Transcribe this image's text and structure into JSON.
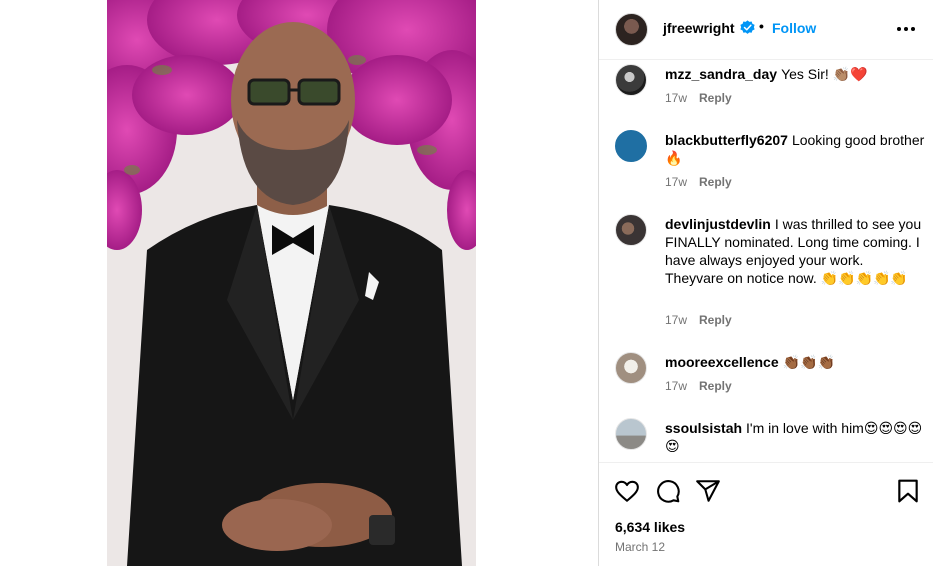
{
  "post": {
    "author": "jfreewright",
    "separator": "•",
    "follow_label": "Follow",
    "likes": "6,634 likes",
    "date": "March 12"
  },
  "comments": [
    {
      "user": "mzz_sandra_day",
      "text": "Yes Sir! 👏🏽❤️",
      "time": "17w",
      "reply": "Reply"
    },
    {
      "user": "blackbutterfly6207",
      "text": "Looking good brother 🔥",
      "time": "17w",
      "reply": "Reply"
    },
    {
      "user": "devlinjustdevlin",
      "text": "I was thrilled to see you FINALLY nominated. Long time coming. I have always enjoyed your work. Theyvare on notice now. 👏👏👏👏👏",
      "time": "17w",
      "reply": "Reply"
    },
    {
      "user": "mooreexcellence",
      "text": "👏🏾👏🏾👏🏾",
      "time": "17w",
      "reply": "Reply"
    },
    {
      "user": "ssoulsistah",
      "text": "I'm in love with him😍😍😍😍😍",
      "time": "",
      "reply": ""
    }
  ],
  "colors": {
    "accent": "#0095f6",
    "muted": "#737373"
  },
  "icons": [
    "verified-badge-icon",
    "more-options-icon",
    "heart-icon",
    "comment-icon",
    "share-icon",
    "bookmark-icon"
  ]
}
